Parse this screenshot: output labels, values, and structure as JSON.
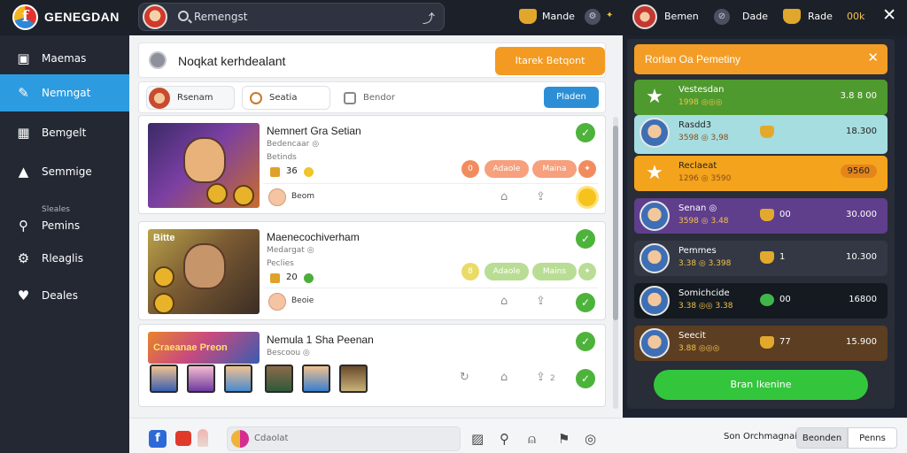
{
  "app": {
    "title": "GENEGDAN"
  },
  "topbar": {
    "search_text": "Remengst",
    "share_icon": "share-icon",
    "user1": "Mande",
    "user2": "Bemen",
    "badge_label": "Dade",
    "coins_label": "Rade",
    "coins_value": "00k"
  },
  "sidebar": {
    "items": [
      {
        "label": "Maemas",
        "icon": "tablet-icon"
      },
      {
        "label": "Nemngat",
        "icon": "edit-icon",
        "active": true
      },
      {
        "label": "Bemgelt",
        "icon": "calendar-icon"
      },
      {
        "label": "Semmige",
        "icon": "user-icon"
      },
      {
        "label": "Pemins",
        "sub": "Sleales",
        "icon": "pin-icon"
      },
      {
        "label": "Rleaglis",
        "icon": "settings-icon"
      },
      {
        "label": "Deales",
        "icon": "heart-icon"
      }
    ]
  },
  "main": {
    "header_title": "Noqkat kerhdealant",
    "header_button": "Itarek Betqont",
    "tabs": [
      {
        "label": "Rsenam"
      },
      {
        "label": "Seatia"
      },
      {
        "label": "Bendor"
      }
    ],
    "tab_button": "Pladen",
    "cards": [
      {
        "title": "Nemnert Gra Setian",
        "sub": "Bedencaar ◎",
        "label": "Betinds",
        "stat1": "36",
        "stat2": "Beom",
        "pill1": "Adaole",
        "pill2": "Maina"
      },
      {
        "title": "Maenecochiverham",
        "sub": "Medargat ◎",
        "label": "Peclies",
        "stat1": "20",
        "stat2": "Beoie",
        "pill1": "Adaole",
        "pill2": "Mains",
        "thumb_text": "Bitte"
      },
      {
        "title": "Nemula 1 Sha Peenan",
        "sub": "Bescoou ◎",
        "thumb_text": "Craeanae Preon",
        "stat3": "2",
        "stat4": "2"
      }
    ]
  },
  "bottombar": {
    "input_text": "Cdaolat"
  },
  "rpanel": {
    "title": "Rorlan Oa Pemetiny",
    "rows": [
      {
        "name": "Vestesdan",
        "sub": "1998 ◎◎◎",
        "mid": "",
        "value": "3.8 8 00",
        "bg": "#4f9a2f",
        "text": "#fff",
        "icon": "star"
      },
      {
        "name": "Rasdd3",
        "sub": "3598 ◎ 3,98",
        "mid": "",
        "value": "18.300",
        "bg": "#a6dde0",
        "text": "#222",
        "icon": "avatar"
      },
      {
        "name": "Reclaeat",
        "sub": "1296 ◎ 3590",
        "mid": "",
        "value": "9560",
        "bg": "#f3a31c",
        "text": "#222",
        "icon": "star"
      },
      {
        "name": "Senan ◎",
        "sub": "3598 ◎ 3.48",
        "mid": "00",
        "value": "30.000",
        "bg": "#5f3e8c",
        "text": "#fff",
        "icon": "avatar"
      },
      {
        "name": "Pemmes",
        "sub": "3.38 ◎ 3.398",
        "mid": "1",
        "value": "10.300",
        "bg": "#333844",
        "text": "#fff",
        "icon": "avatar"
      },
      {
        "name": "Somichcide",
        "sub": "3.38 ◎◎ 3.38",
        "mid": "00",
        "value": "16800",
        "bg": "#141a20",
        "text": "#fff",
        "icon": "avatar"
      },
      {
        "name": "Seecit",
        "sub": "3.88 ◎◎◎",
        "mid": "77",
        "value": "15.900",
        "bg": "#5c3e22",
        "text": "#fff",
        "icon": "avatar"
      }
    ],
    "button": "Bran Ikenine"
  },
  "rbottom": {
    "label": "Son Orchmagnai",
    "btn1": "Beonden",
    "btn2": "Penns"
  },
  "colors": {
    "accent": "#2d9be0",
    "orange": "#f39a22",
    "green": "#33c63c"
  }
}
